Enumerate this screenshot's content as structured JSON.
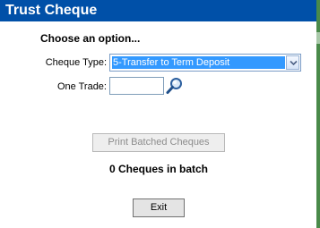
{
  "window": {
    "title": "Trust Cheque"
  },
  "form": {
    "prompt": "Choose an option...",
    "cheque_type_label": "Cheque Type:",
    "cheque_type_value": "5-Transfer to Term Deposit",
    "one_trade_label": "One Trade:",
    "one_trade_value": ""
  },
  "actions": {
    "print_label": "Print Batched Cheques",
    "batch_status": "0 Cheques in batch",
    "exit_label": "Exit"
  },
  "icons": {
    "dropdown": "chevron-down-icon",
    "search": "magnifier-icon"
  },
  "colors": {
    "title_bar": "#0050a8",
    "selection": "#3399ff"
  }
}
